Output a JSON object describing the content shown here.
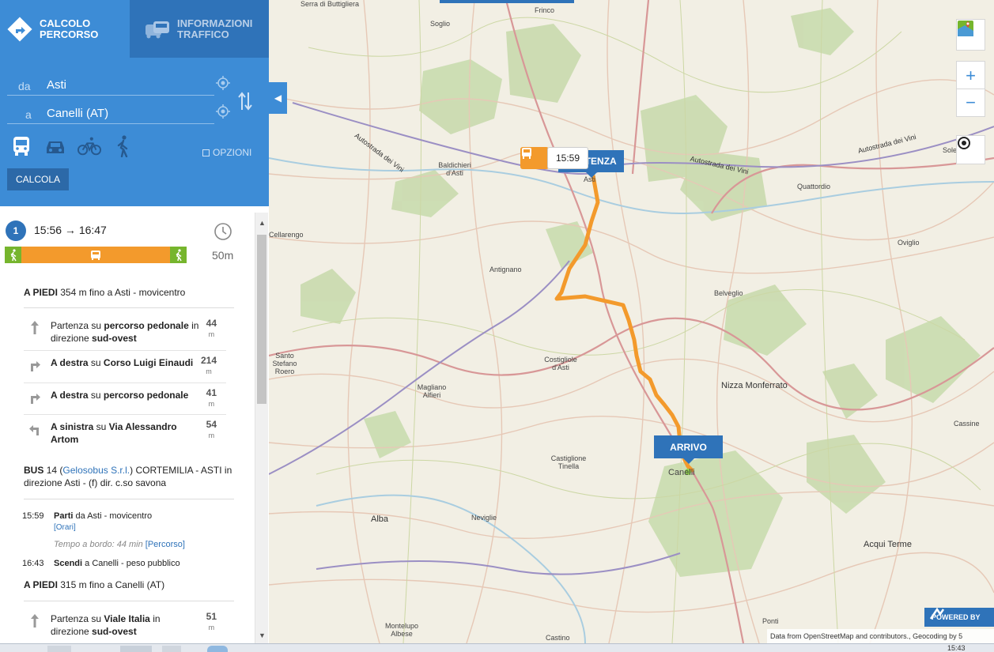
{
  "tabs": {
    "route": "CALCOLO PERCORSO",
    "traffic": "INFORMAZIONI TRAFFICO"
  },
  "form": {
    "from_label": "da",
    "from_value": "Asti",
    "to_label": "a",
    "to_value": "Canelli (AT)",
    "options_label": "OPZIONI",
    "calculate_label": "CALCOLA",
    "modes": [
      "bus-icon",
      "car-icon",
      "bicycle-icon",
      "walk-icon"
    ]
  },
  "solution": {
    "number": "1",
    "time_range": "15:56 → 16:47",
    "duration": "50m"
  },
  "segments": {
    "walk1_mode": "A PIEDI",
    "walk1_rest": "354 m fino a Asti - movicentro",
    "steps1": [
      {
        "pre": "Partenza su ",
        "bold": "percorso pedonale",
        "post": " in direzione ",
        "bold2": "sud-ovest",
        "dist": "44",
        "unit": "m"
      },
      {
        "pre": "",
        "bold": "A destra",
        "post": " su ",
        "bold2": "Corso Luigi Einaudi",
        "dist": "214",
        "unit": "m"
      },
      {
        "pre": "",
        "bold": "A destra",
        "post": " su ",
        "bold2": "percorso pedonale",
        "dist": "41",
        "unit": "m"
      },
      {
        "pre": "",
        "bold": "A sinistra",
        "post": " su ",
        "bold2": "Via Alessandro Artom",
        "dist": "54",
        "unit": "m"
      }
    ],
    "bus_mode": "BUS",
    "bus_line": "14",
    "bus_operator": "Gelosobus S.r.l.",
    "bus_rest": "CORTEMILIA - ASTI in direzione Asti - (f) dir. c.so savona",
    "bus_depart_time": "15:59",
    "bus_depart_verb": "Parti",
    "bus_depart_text": "da Asti - movicentro",
    "bus_timetable": "[Orari]",
    "bus_onboard": "Tempo a bordo: 44 min",
    "bus_route_link": "[Percorso]",
    "bus_arrive_time": "16:43",
    "bus_arrive_verb": "Scendi",
    "bus_arrive_text": "a Canelli - peso pubblico",
    "walk2_mode": "A PIEDI",
    "walk2_rest": "315 m fino a Canelli (AT)",
    "step2": {
      "pre": "Partenza su ",
      "bold": "Viale Italia",
      "post": " in direzione ",
      "bold2": "sud-ovest",
      "dist": "51",
      "unit": "m"
    }
  },
  "map": {
    "bus_marker_time": "15:59",
    "start_label": "PARTENZA",
    "end_label": "ARRIVO",
    "powered_by": "POWERED BY",
    "attribution": "Data from OpenStreetMap and contributors., Geocoding by 5",
    "zoom_in": "+",
    "zoom_out": "−",
    "places": [
      {
        "name": "Serra di Buttigliera",
        "cls": ""
      },
      {
        "name": "Frinco",
        "cls": ""
      },
      {
        "name": "Soglio",
        "cls": ""
      },
      {
        "name": "Baldichieri d'Asti",
        "cls": ""
      },
      {
        "name": "Asti",
        "cls": ""
      },
      {
        "name": "Quattordio",
        "cls": ""
      },
      {
        "name": "Solero",
        "cls": ""
      },
      {
        "name": "Cellarengo",
        "cls": ""
      },
      {
        "name": "Antignano",
        "cls": ""
      },
      {
        "name": "Oviglio",
        "cls": ""
      },
      {
        "name": "Belveglio",
        "cls": ""
      },
      {
        "name": "Costigliole d'Asti",
        "cls": ""
      },
      {
        "name": "Nizza Monferrato",
        "cls": "big"
      },
      {
        "name": "Magliano Alfieri",
        "cls": ""
      },
      {
        "name": "Castiglione Tinella",
        "cls": ""
      },
      {
        "name": "Canelli",
        "cls": ""
      },
      {
        "name": "Cassine",
        "cls": ""
      },
      {
        "name": "Alba",
        "cls": "big"
      },
      {
        "name": "Neviglie",
        "cls": ""
      },
      {
        "name": "Acqui Terme",
        "cls": "big"
      },
      {
        "name": "Montelupo Albese",
        "cls": ""
      },
      {
        "name": "Castino",
        "cls": ""
      },
      {
        "name": "Ponti",
        "cls": ""
      },
      {
        "name": "Santo Stefano Roero",
        "cls": ""
      }
    ],
    "roads": [
      "Autostrada dei Vini",
      "Autostrada dei Vini",
      "Autostrada dei Vini"
    ]
  },
  "taskbar": {
    "clock": "15:43"
  },
  "colors": {
    "primary": "#3d8cd6",
    "primary_dark": "#2f73b9",
    "route": "#f39a2c",
    "walk": "#76b52d"
  }
}
